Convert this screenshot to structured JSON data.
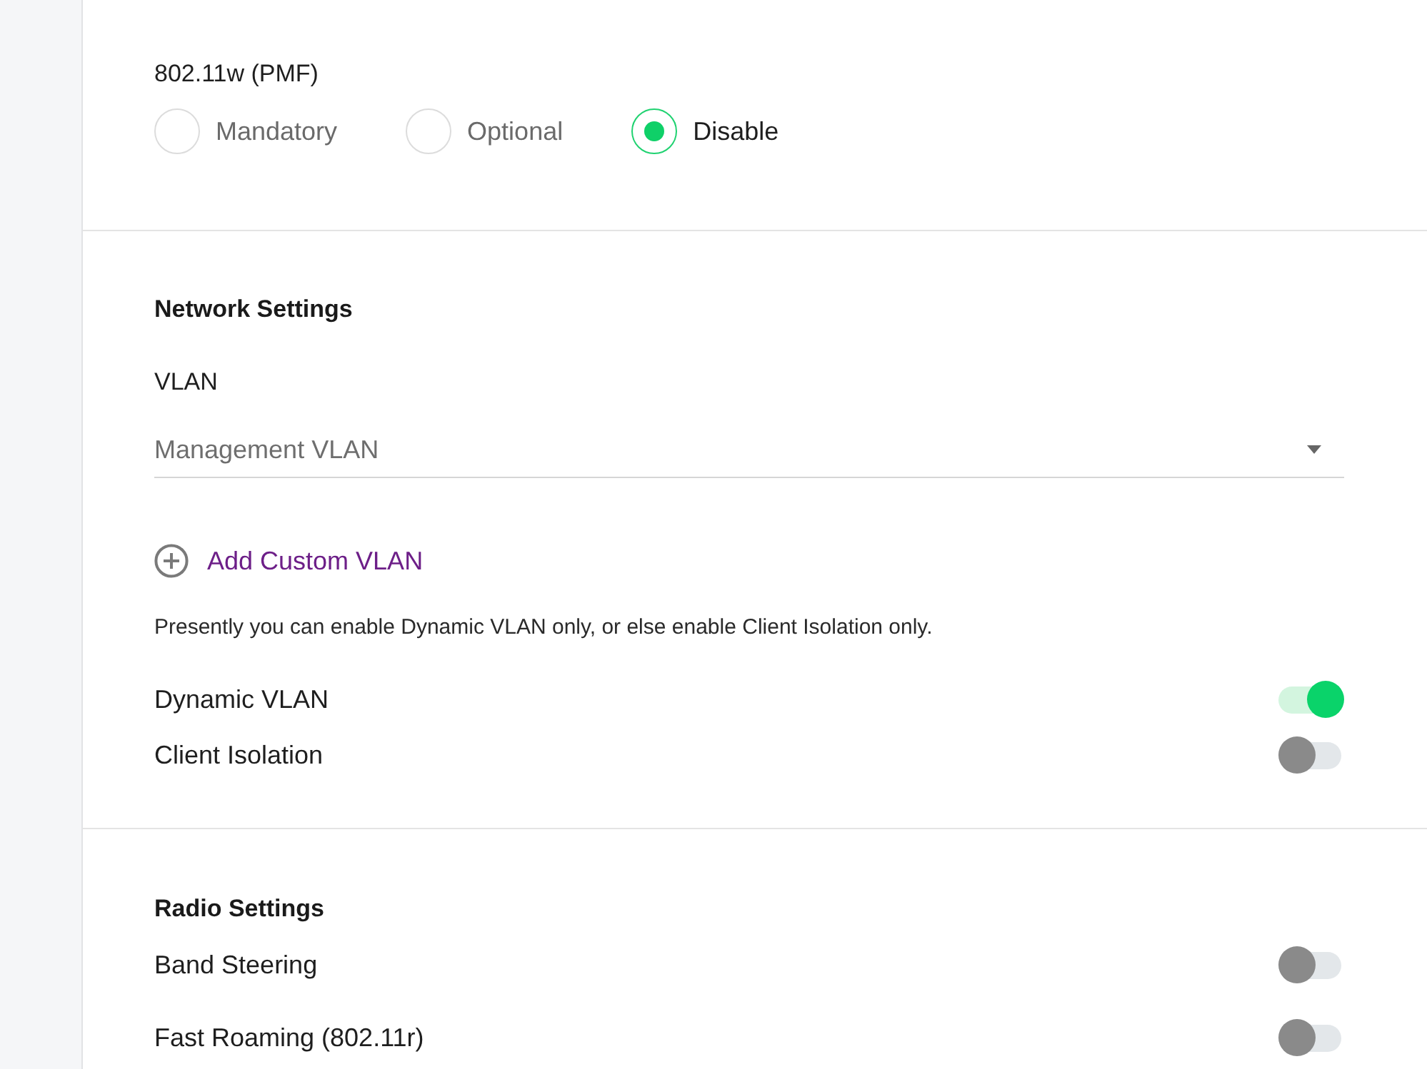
{
  "pmf": {
    "label": "802.11w (PMF)",
    "options": [
      {
        "label": "Mandatory",
        "selected": false
      },
      {
        "label": "Optional",
        "selected": false
      },
      {
        "label": "Disable",
        "selected": true
      }
    ]
  },
  "network_settings": {
    "title": "Network Settings",
    "vlan": {
      "label": "VLAN",
      "value": "Management VLAN"
    },
    "add_custom_vlan": "Add Custom VLAN",
    "note": "Presently you can enable Dynamic VLAN only, or else enable Client Isolation only.",
    "toggles": [
      {
        "label": "Dynamic VLAN",
        "on": true
      },
      {
        "label": "Client Isolation",
        "on": false
      }
    ]
  },
  "radio_settings": {
    "title": "Radio Settings",
    "toggles": [
      {
        "label": "Band Steering",
        "on": false
      },
      {
        "label": "Fast Roaming (802.11r)",
        "on": false
      }
    ]
  }
}
